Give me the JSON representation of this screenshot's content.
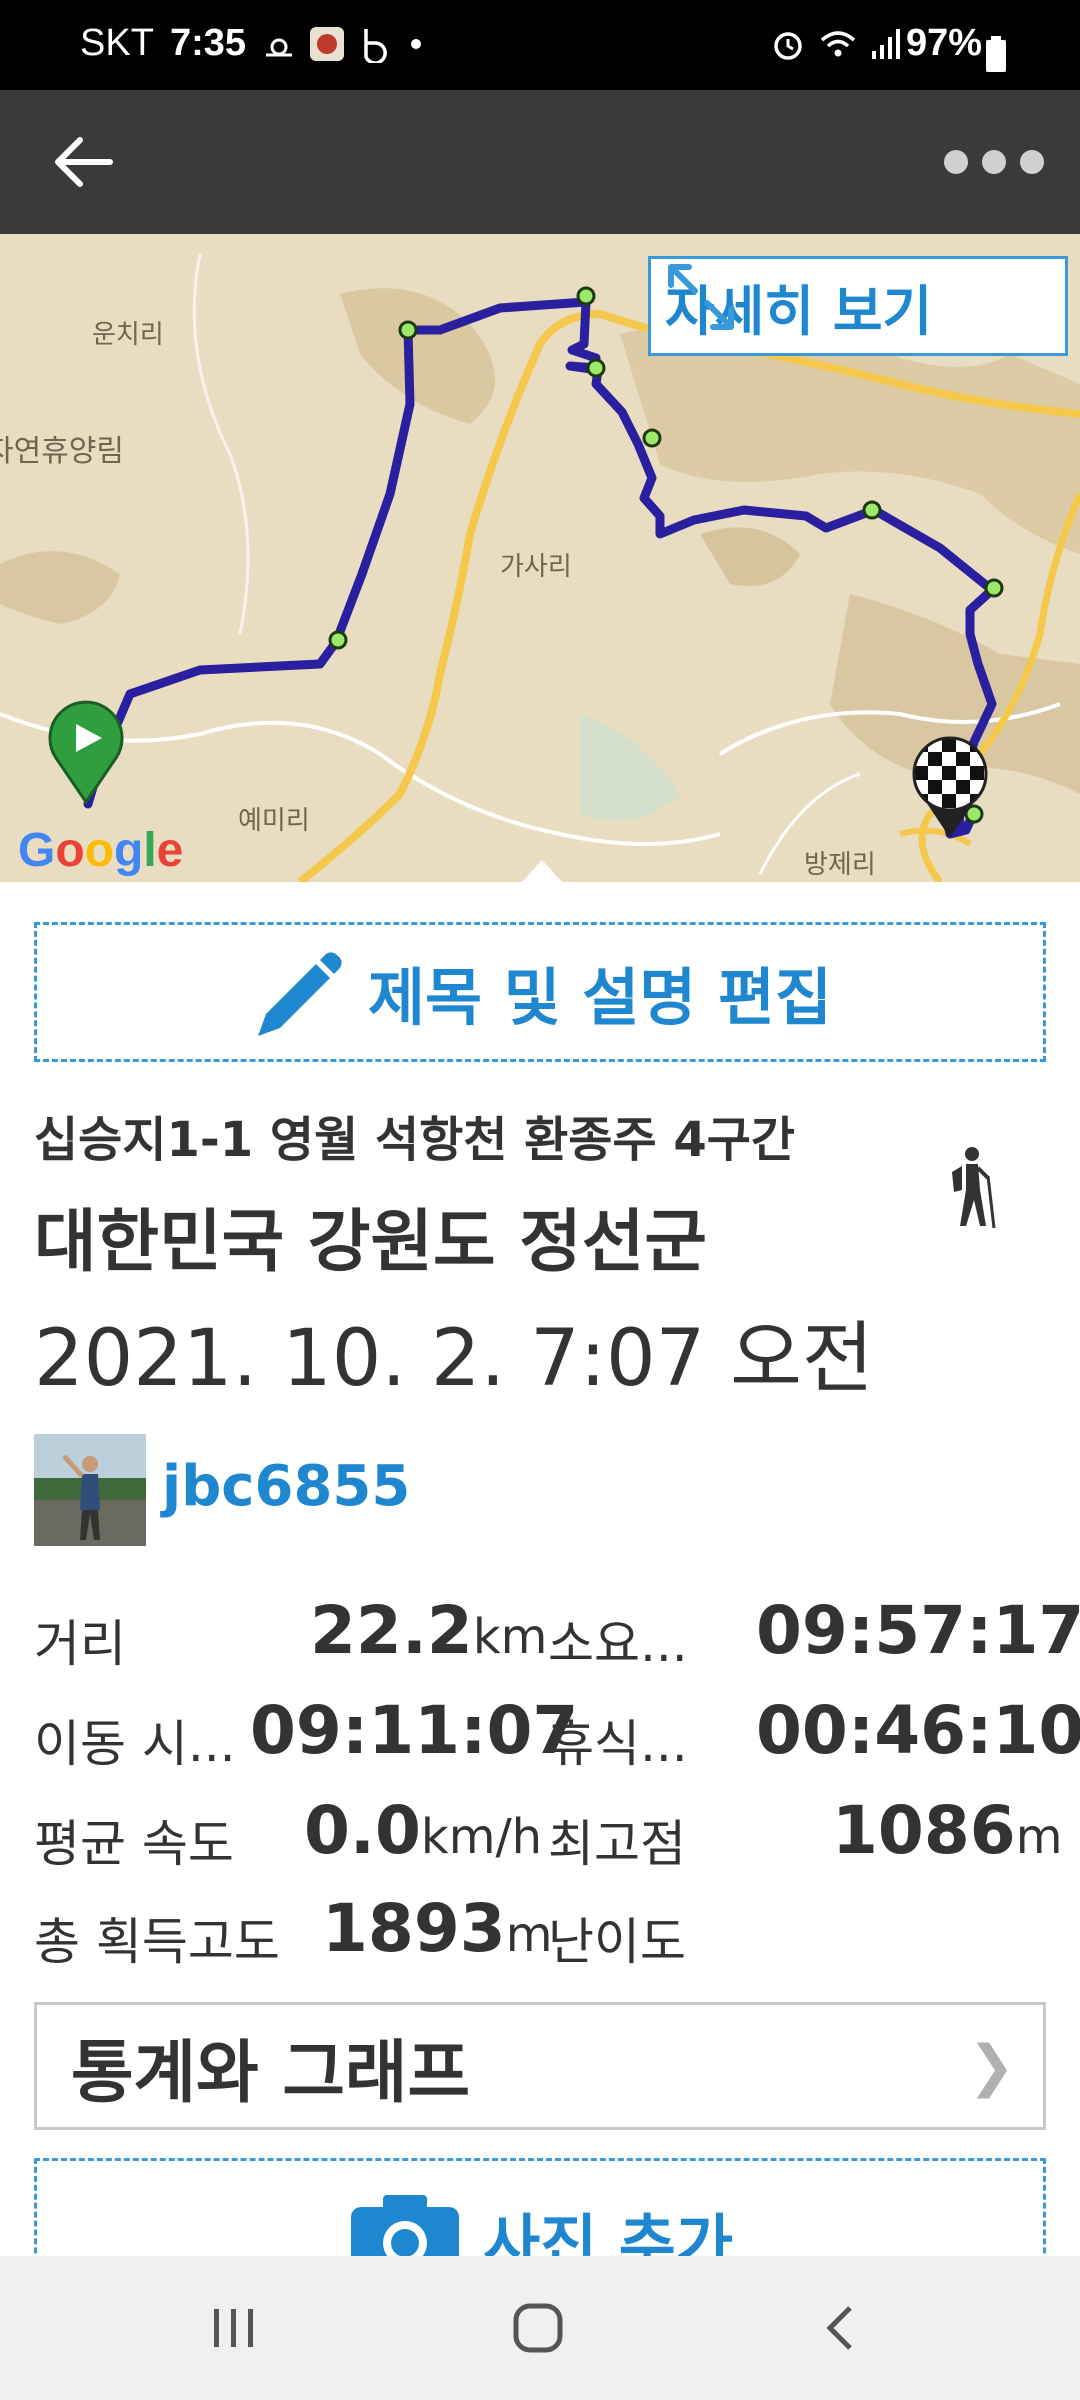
{
  "status_bar": {
    "carrier": "SKT",
    "time": "7:35",
    "battery": "97%",
    "left_icons": [
      "weather-icon",
      "app-icon",
      "b-app-icon",
      "dot-icon"
    ],
    "right_icons": [
      "alarm-icon",
      "wifi-icon",
      "signal-icon",
      "battery-icon"
    ]
  },
  "app_bar": {
    "back_icon": "arrow-left-icon",
    "menu_icon": "more-dots-icon"
  },
  "map": {
    "detail_button": "자세히 보기",
    "labels": [
      "운치리",
      "자연휴양림",
      "가사리",
      "예미리",
      "방제리"
    ],
    "google_logo": "Google",
    "start_marker": "play-marker-icon",
    "finish_marker": "checkered-flag-icon",
    "route_color": "#2a1f9e"
  },
  "edit_title": {
    "label": "제목 및 설명 편집",
    "icon": "pencil-icon"
  },
  "track": {
    "name": "십승지1-1 영월 석항천 환종주 4구간",
    "location": "대한민국 강원도 정선군",
    "datetime": "2021. 10. 2. 7:07 오전",
    "activity_icon": "hiker-icon"
  },
  "user": {
    "username": "jbc6855"
  },
  "stats": {
    "distance_label": "거리",
    "distance_value": "22.2",
    "distance_unit": "km",
    "duration_label": "소요...",
    "duration_value": "09:57:17",
    "moving_label": "이동 시...",
    "moving_value": "09:11:07",
    "rest_label": "휴식...",
    "rest_value": "00:46:10",
    "avg_speed_label": "평균 속도",
    "avg_speed_value": "0.0",
    "avg_speed_unit": "km/h",
    "max_alt_label": "최고점",
    "max_alt_value": "1086",
    "max_alt_unit": "m",
    "gain_label": "총 획득고도",
    "gain_value": "1893",
    "gain_unit": "m",
    "difficulty_label": "난이도"
  },
  "stats_button": {
    "label": "통계와 그래프",
    "chevron": "❯"
  },
  "add_photo": {
    "label": "사진 추가",
    "icon": "camera-icon"
  },
  "nav_bar": {
    "items": [
      "recents-icon",
      "home-icon",
      "back-icon"
    ]
  },
  "colors": {
    "accent": "#1f87d0",
    "app_bar": "#3a3a3a",
    "map_bg": "#e8dcc0"
  }
}
